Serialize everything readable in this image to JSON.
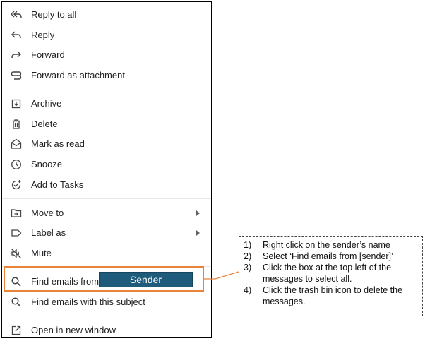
{
  "menu": {
    "group1": [
      {
        "label": "Reply to all",
        "icon": "reply-all-icon"
      },
      {
        "label": "Reply",
        "icon": "reply-icon"
      },
      {
        "label": "Forward",
        "icon": "forward-icon"
      },
      {
        "label": "Forward as attachment",
        "icon": "attachment-icon"
      }
    ],
    "group2": [
      {
        "label": "Archive",
        "icon": "archive-icon"
      },
      {
        "label": "Delete",
        "icon": "trash-icon"
      },
      {
        "label": "Mark as read",
        "icon": "open-envelope-icon"
      },
      {
        "label": "Snooze",
        "icon": "clock-icon"
      },
      {
        "label": "Add to Tasks",
        "icon": "add-task-icon"
      }
    ],
    "group3": [
      {
        "label": "Move to",
        "icon": "move-to-folder-icon",
        "submenu": true
      },
      {
        "label": "Label as",
        "icon": "label-icon",
        "submenu": true
      },
      {
        "label": "Mute",
        "icon": "mute-icon"
      }
    ],
    "group4": [
      {
        "label": "Find emails from",
        "icon": "search-icon"
      },
      {
        "label": "Find emails with this subject",
        "icon": "search-icon"
      }
    ],
    "group5": [
      {
        "label": "Open in new window",
        "icon": "open-external-icon"
      }
    ]
  },
  "overlay": {
    "sender_label": "Sender",
    "highlight_color": "#e8833a",
    "sender_box_color": "#1f5b7a"
  },
  "instructions": [
    {
      "num": "1)",
      "text": "Right click on the sender’s name"
    },
    {
      "num": "2)",
      "text": "Select ‘Find emails from [sender]’"
    },
    {
      "num": "3)",
      "text": "Click the box at the top left of the messages to select all."
    },
    {
      "num": "4)",
      "text": "Click the trash bin icon to delete the messages."
    }
  ]
}
